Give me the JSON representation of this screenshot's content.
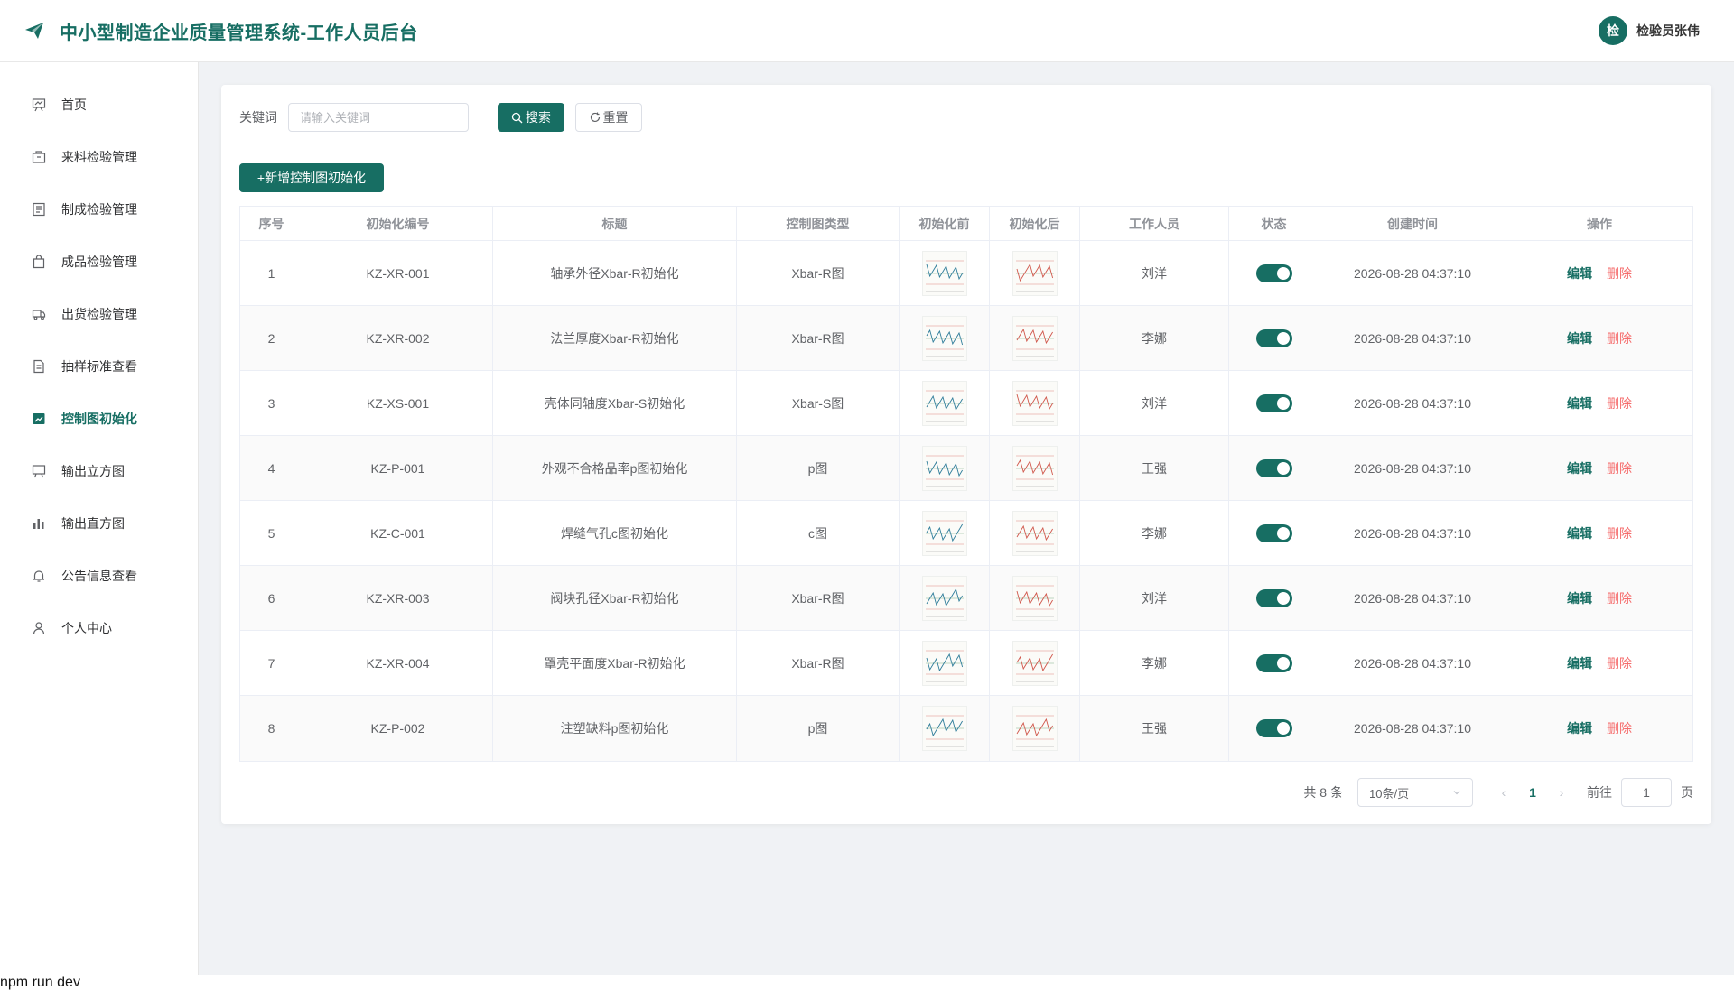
{
  "header": {
    "title": "中小型制造企业质量管理系统-工作人员后台",
    "avatar_text": "检",
    "user_name": "检验员张伟",
    "logo_icon": "paper-plane-icon"
  },
  "theme": {
    "primary": "#176e63",
    "danger": "#f56c6c",
    "bg": "#f0f2f5"
  },
  "sidebar": {
    "items": [
      {
        "label": "首页",
        "icon": "presentation-board-icon",
        "active": false
      },
      {
        "label": "来料检验管理",
        "icon": "package-icon",
        "active": false
      },
      {
        "label": "制成检验管理",
        "icon": "list-document-icon",
        "active": false
      },
      {
        "label": "成品检验管理",
        "icon": "shopping-bag-icon",
        "active": false
      },
      {
        "label": "出货检验管理",
        "icon": "truck-icon",
        "active": false
      },
      {
        "label": "抽样标准查看",
        "icon": "document-icon",
        "active": false
      },
      {
        "label": "控制图初始化",
        "icon": "line-chart-icon",
        "active": true
      },
      {
        "label": "输出立方图",
        "icon": "easel-icon",
        "active": false
      },
      {
        "label": "输出直方图",
        "icon": "bar-chart-icon",
        "active": false
      },
      {
        "label": "公告信息查看",
        "icon": "bell-icon",
        "active": false
      },
      {
        "label": "个人中心",
        "icon": "user-icon",
        "active": false
      }
    ]
  },
  "search": {
    "keyword_label": "关键词",
    "keyword_placeholder": "请输入关键词",
    "keyword_value": "",
    "search_button": "搜索",
    "reset_button": "重置",
    "add_button": "+新增控制图初始化"
  },
  "table": {
    "columns": [
      "序号",
      "初始化编号",
      "标题",
      "控制图类型",
      "初始化前",
      "初始化后",
      "工作人员",
      "状态",
      "创建时间",
      "操作"
    ],
    "edit_label": "编辑",
    "delete_label": "删除",
    "rows": [
      {
        "index": "1",
        "code": "KZ-XR-001",
        "title": "轴承外径Xbar-R初始化",
        "type": "Xbar-R图",
        "worker": "刘洋",
        "status": true,
        "created": "2026-08-28 04:37:10"
      },
      {
        "index": "2",
        "code": "KZ-XR-002",
        "title": "法兰厚度Xbar-R初始化",
        "type": "Xbar-R图",
        "worker": "李娜",
        "status": true,
        "created": "2026-08-28 04:37:10"
      },
      {
        "index": "3",
        "code": "KZ-XS-001",
        "title": "壳体同轴度Xbar-S初始化",
        "type": "Xbar-S图",
        "worker": "刘洋",
        "status": true,
        "created": "2026-08-28 04:37:10"
      },
      {
        "index": "4",
        "code": "KZ-P-001",
        "title": "外观不合格品率p图初始化",
        "type": "p图",
        "worker": "王强",
        "status": true,
        "created": "2026-08-28 04:37:10"
      },
      {
        "index": "5",
        "code": "KZ-C-001",
        "title": "焊缝气孔c图初始化",
        "type": "c图",
        "worker": "李娜",
        "status": true,
        "created": "2026-08-28 04:37:10"
      },
      {
        "index": "6",
        "code": "KZ-XR-003",
        "title": "阀块孔径Xbar-R初始化",
        "type": "Xbar-R图",
        "worker": "刘洋",
        "status": true,
        "created": "2026-08-28 04:37:10"
      },
      {
        "index": "7",
        "code": "KZ-XR-004",
        "title": "罩壳平面度Xbar-R初始化",
        "type": "Xbar-R图",
        "worker": "李娜",
        "status": true,
        "created": "2026-08-28 04:37:10"
      },
      {
        "index": "8",
        "code": "KZ-P-002",
        "title": "注塑缺料p图初始化",
        "type": "p图",
        "worker": "王强",
        "status": true,
        "created": "2026-08-28 04:37:10"
      }
    ]
  },
  "pagination": {
    "total_text": "共 8 条",
    "page_size": "10条/页",
    "current_page": "1",
    "goto_label": "前往",
    "goto_value": "1",
    "page_suffix": "页"
  },
  "terminal": {
    "text": "npm run dev"
  }
}
